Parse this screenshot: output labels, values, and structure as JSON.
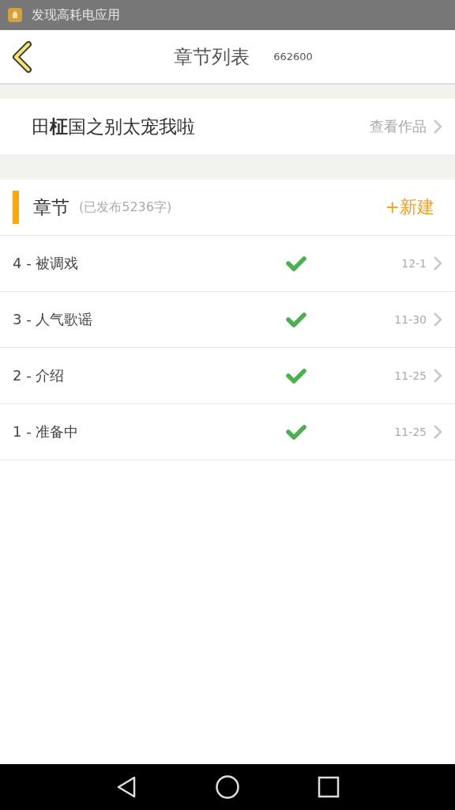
{
  "status_bar": {
    "notification": "发现高耗电应用"
  },
  "header": {
    "title": "章节列表",
    "id": "662600"
  },
  "book": {
    "title": "田**柾**国之别太宠我啦",
    "link": "查看作品"
  },
  "section": {
    "title": "章节",
    "summary": "(已发布5236字)",
    "new_button": "+新建"
  },
  "chapters": [
    {
      "title": "4 - 被调戏",
      "published": true,
      "date": "12-1"
    },
    {
      "title": "3 - 人气歌谣",
      "published": true,
      "date": "11-30"
    },
    {
      "title": "2 - 介绍",
      "published": true,
      "date": "11-25"
    },
    {
      "title": "1 - 准备中",
      "published": true,
      "date": "11-25"
    }
  ]
}
